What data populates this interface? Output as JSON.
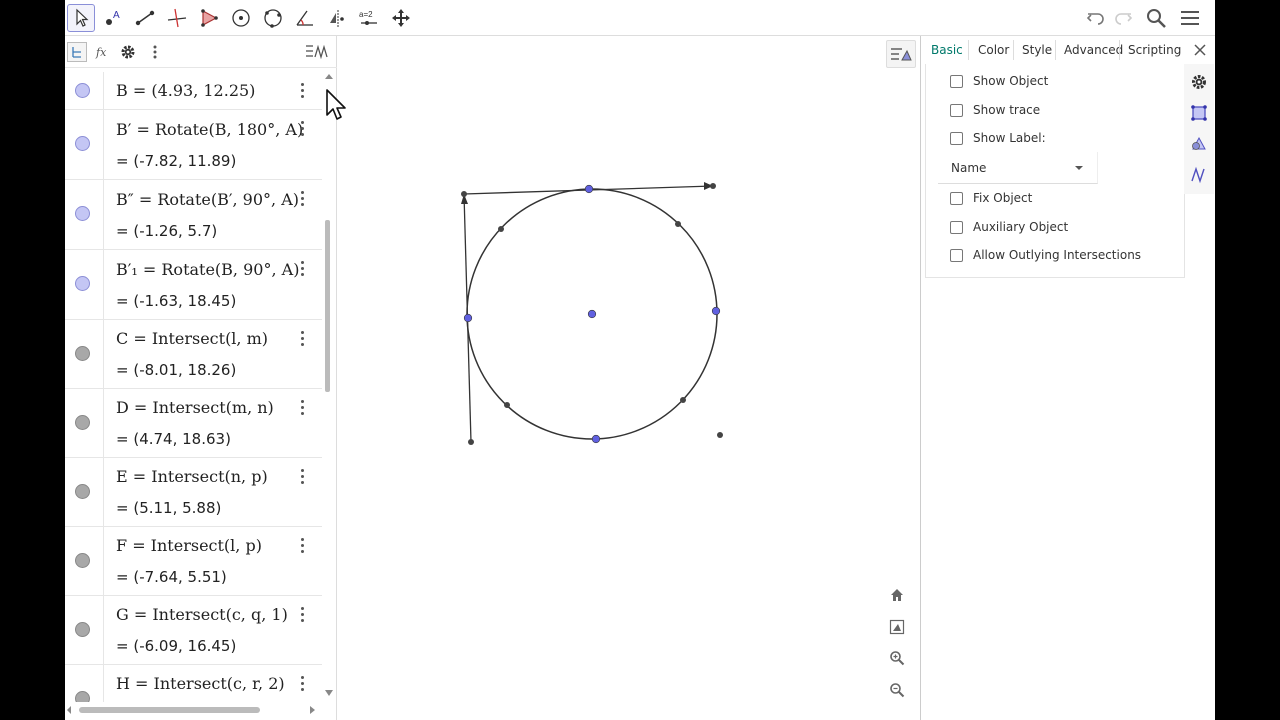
{
  "algebra": {
    "items": [
      {
        "def": "B = (4.93, 12.25)",
        "val": "",
        "marble": "purple"
      },
      {
        "def": "B′ = Rotate(B, 180°, A)",
        "val": "= (-7.82, 11.89)",
        "marble": "purple"
      },
      {
        "def": "B″ = Rotate(B′, 90°, A)",
        "val": "= (-1.26, 5.7)",
        "marble": "purple"
      },
      {
        "def": "B′₁ = Rotate(B, 90°, A)",
        "val": "= (-1.63, 18.45)",
        "marble": "purple"
      },
      {
        "def": "C = Intersect(l, m)",
        "val": "= (-8.01, 18.26)",
        "marble": "gray"
      },
      {
        "def": "D = Intersect(m, n)",
        "val": "= (4.74, 18.63)",
        "marble": "gray"
      },
      {
        "def": "E = Intersect(n, p)",
        "val": "= (5.11, 5.88)",
        "marble": "gray"
      },
      {
        "def": "F = Intersect(l, p)",
        "val": "= (-7.64, 5.51)",
        "marble": "gray"
      },
      {
        "def": "G = Intersect(c, q, 1)",
        "val": "= (-6.09, 16.45)",
        "marble": "gray"
      },
      {
        "def": "H = Intersect(c, r, 2)",
        "val": "",
        "marble": "gray"
      }
    ]
  },
  "properties": {
    "tabs": [
      "Basic",
      "Color",
      "Style",
      "Advanced",
      "Scripting"
    ],
    "active_tab": "Basic",
    "checkboxes": {
      "show_object": "Show Object",
      "show_trace": "Show trace",
      "show_label": "Show Label:",
      "fix_object": "Fix Object",
      "auxiliary_object": "Auxiliary Object",
      "allow_outlying": "Allow Outlying Intersections"
    },
    "label_select": "Name"
  },
  "toolbar": {
    "tools": [
      "move-tool-icon",
      "point-tool-icon",
      "segment-tool-icon",
      "perpendicular-line-tool-icon",
      "polygon-tool-icon",
      "circle-center-point-tool-icon",
      "circle-three-points-tool-icon",
      "angle-tool-icon",
      "reflect-tool-icon",
      "slider-tool-icon",
      "move-graphics-view-tool-icon"
    ],
    "slider_glyph": "a=2"
  },
  "colors": {
    "accent": "#8a8fd8",
    "point_blue": "#6060e0",
    "point_dark": "#444444",
    "tab_active": "#00796b"
  }
}
